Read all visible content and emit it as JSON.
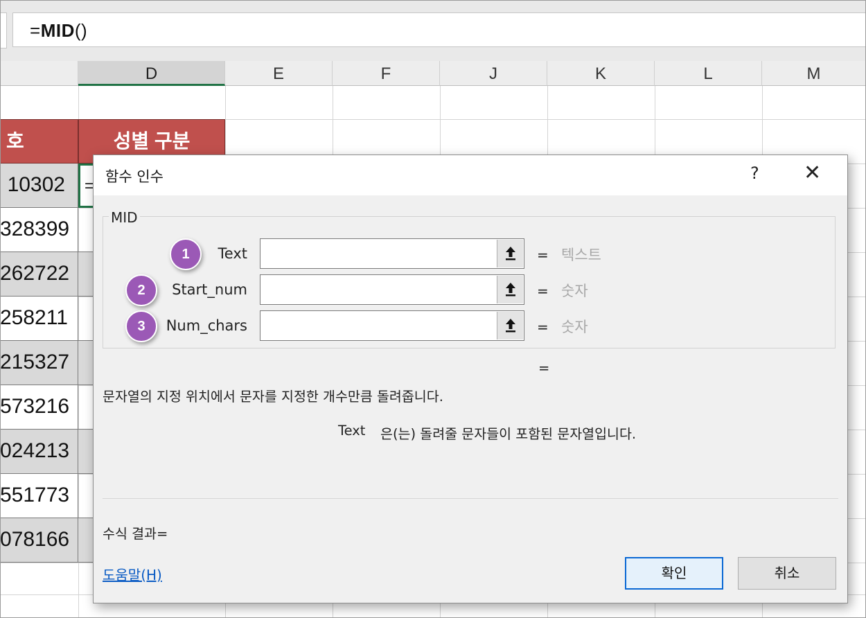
{
  "formula_bar": {
    "prefix": "=",
    "func": "MID",
    "suffix": "()"
  },
  "columns": [
    "D",
    "E",
    "F",
    "J",
    "K",
    "L",
    "M"
  ],
  "sheet": {
    "header_left": "호",
    "header_d": "성별 구분",
    "active_cell_text": "=",
    "numbers": [
      "10302",
      "328399",
      "262722",
      "258211",
      "215327",
      "573216",
      "024213",
      "551773",
      "078166"
    ]
  },
  "dialog": {
    "title": "함수 인수",
    "help_symbol": "?",
    "close_symbol": "✕",
    "function_name": "MID",
    "args": [
      {
        "badge": "1",
        "label": "Text",
        "value": "",
        "equals": "=",
        "hint": "텍스트"
      },
      {
        "badge": "2",
        "label": "Start_num",
        "value": "",
        "equals": "=",
        "hint": "숫자"
      },
      {
        "badge": "3",
        "label": "Num_chars",
        "value": "",
        "equals": "=",
        "hint": "숫자"
      }
    ],
    "result_equals": "=",
    "description": "문자열의 지정 위치에서 문자를 지정한 개수만큼 돌려줍니다.",
    "arg_name": "Text",
    "arg_description": "은(는) 돌려줄 문자들이 포함된 문자열입니다.",
    "formula_result_label": "수식 결과=",
    "help_link": "도움말(H)",
    "ok_label": "확인",
    "cancel_label": "취소"
  },
  "colors": {
    "header_red": "#c0504d",
    "badge_purple": "#9b59b6",
    "excel_green": "#217346",
    "link_blue": "#0a5bc4"
  }
}
